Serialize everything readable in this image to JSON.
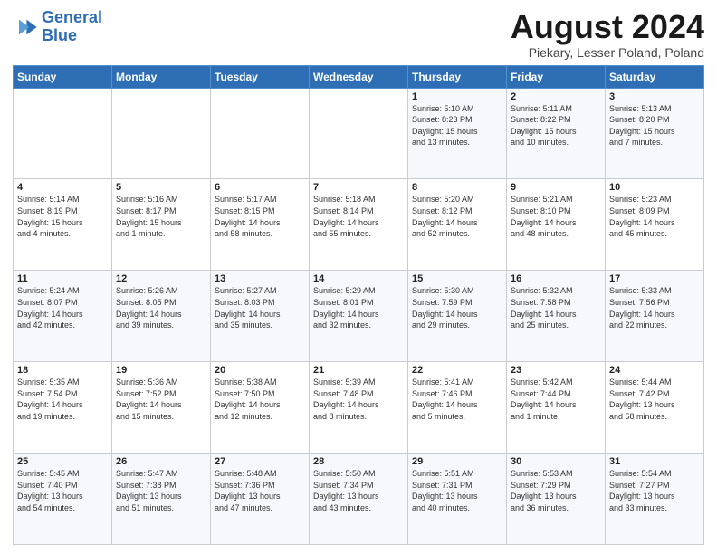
{
  "header": {
    "logo_line1": "General",
    "logo_line2": "Blue",
    "month": "August 2024",
    "location": "Piekary, Lesser Poland, Poland"
  },
  "weekdays": [
    "Sunday",
    "Monday",
    "Tuesday",
    "Wednesday",
    "Thursday",
    "Friday",
    "Saturday"
  ],
  "weeks": [
    [
      {
        "day": "",
        "info": ""
      },
      {
        "day": "",
        "info": ""
      },
      {
        "day": "",
        "info": ""
      },
      {
        "day": "",
        "info": ""
      },
      {
        "day": "1",
        "info": "Sunrise: 5:10 AM\nSunset: 8:23 PM\nDaylight: 15 hours\nand 13 minutes."
      },
      {
        "day": "2",
        "info": "Sunrise: 5:11 AM\nSunset: 8:22 PM\nDaylight: 15 hours\nand 10 minutes."
      },
      {
        "day": "3",
        "info": "Sunrise: 5:13 AM\nSunset: 8:20 PM\nDaylight: 15 hours\nand 7 minutes."
      }
    ],
    [
      {
        "day": "4",
        "info": "Sunrise: 5:14 AM\nSunset: 8:19 PM\nDaylight: 15 hours\nand 4 minutes."
      },
      {
        "day": "5",
        "info": "Sunrise: 5:16 AM\nSunset: 8:17 PM\nDaylight: 15 hours\nand 1 minute."
      },
      {
        "day": "6",
        "info": "Sunrise: 5:17 AM\nSunset: 8:15 PM\nDaylight: 14 hours\nand 58 minutes."
      },
      {
        "day": "7",
        "info": "Sunrise: 5:18 AM\nSunset: 8:14 PM\nDaylight: 14 hours\nand 55 minutes."
      },
      {
        "day": "8",
        "info": "Sunrise: 5:20 AM\nSunset: 8:12 PM\nDaylight: 14 hours\nand 52 minutes."
      },
      {
        "day": "9",
        "info": "Sunrise: 5:21 AM\nSunset: 8:10 PM\nDaylight: 14 hours\nand 48 minutes."
      },
      {
        "day": "10",
        "info": "Sunrise: 5:23 AM\nSunset: 8:09 PM\nDaylight: 14 hours\nand 45 minutes."
      }
    ],
    [
      {
        "day": "11",
        "info": "Sunrise: 5:24 AM\nSunset: 8:07 PM\nDaylight: 14 hours\nand 42 minutes."
      },
      {
        "day": "12",
        "info": "Sunrise: 5:26 AM\nSunset: 8:05 PM\nDaylight: 14 hours\nand 39 minutes."
      },
      {
        "day": "13",
        "info": "Sunrise: 5:27 AM\nSunset: 8:03 PM\nDaylight: 14 hours\nand 35 minutes."
      },
      {
        "day": "14",
        "info": "Sunrise: 5:29 AM\nSunset: 8:01 PM\nDaylight: 14 hours\nand 32 minutes."
      },
      {
        "day": "15",
        "info": "Sunrise: 5:30 AM\nSunset: 7:59 PM\nDaylight: 14 hours\nand 29 minutes."
      },
      {
        "day": "16",
        "info": "Sunrise: 5:32 AM\nSunset: 7:58 PM\nDaylight: 14 hours\nand 25 minutes."
      },
      {
        "day": "17",
        "info": "Sunrise: 5:33 AM\nSunset: 7:56 PM\nDaylight: 14 hours\nand 22 minutes."
      }
    ],
    [
      {
        "day": "18",
        "info": "Sunrise: 5:35 AM\nSunset: 7:54 PM\nDaylight: 14 hours\nand 19 minutes."
      },
      {
        "day": "19",
        "info": "Sunrise: 5:36 AM\nSunset: 7:52 PM\nDaylight: 14 hours\nand 15 minutes."
      },
      {
        "day": "20",
        "info": "Sunrise: 5:38 AM\nSunset: 7:50 PM\nDaylight: 14 hours\nand 12 minutes."
      },
      {
        "day": "21",
        "info": "Sunrise: 5:39 AM\nSunset: 7:48 PM\nDaylight: 14 hours\nand 8 minutes."
      },
      {
        "day": "22",
        "info": "Sunrise: 5:41 AM\nSunset: 7:46 PM\nDaylight: 14 hours\nand 5 minutes."
      },
      {
        "day": "23",
        "info": "Sunrise: 5:42 AM\nSunset: 7:44 PM\nDaylight: 14 hours\nand 1 minute."
      },
      {
        "day": "24",
        "info": "Sunrise: 5:44 AM\nSunset: 7:42 PM\nDaylight: 13 hours\nand 58 minutes."
      }
    ],
    [
      {
        "day": "25",
        "info": "Sunrise: 5:45 AM\nSunset: 7:40 PM\nDaylight: 13 hours\nand 54 minutes."
      },
      {
        "day": "26",
        "info": "Sunrise: 5:47 AM\nSunset: 7:38 PM\nDaylight: 13 hours\nand 51 minutes."
      },
      {
        "day": "27",
        "info": "Sunrise: 5:48 AM\nSunset: 7:36 PM\nDaylight: 13 hours\nand 47 minutes."
      },
      {
        "day": "28",
        "info": "Sunrise: 5:50 AM\nSunset: 7:34 PM\nDaylight: 13 hours\nand 43 minutes."
      },
      {
        "day": "29",
        "info": "Sunrise: 5:51 AM\nSunset: 7:31 PM\nDaylight: 13 hours\nand 40 minutes."
      },
      {
        "day": "30",
        "info": "Sunrise: 5:53 AM\nSunset: 7:29 PM\nDaylight: 13 hours\nand 36 minutes."
      },
      {
        "day": "31",
        "info": "Sunrise: 5:54 AM\nSunset: 7:27 PM\nDaylight: 13 hours\nand 33 minutes."
      }
    ]
  ]
}
